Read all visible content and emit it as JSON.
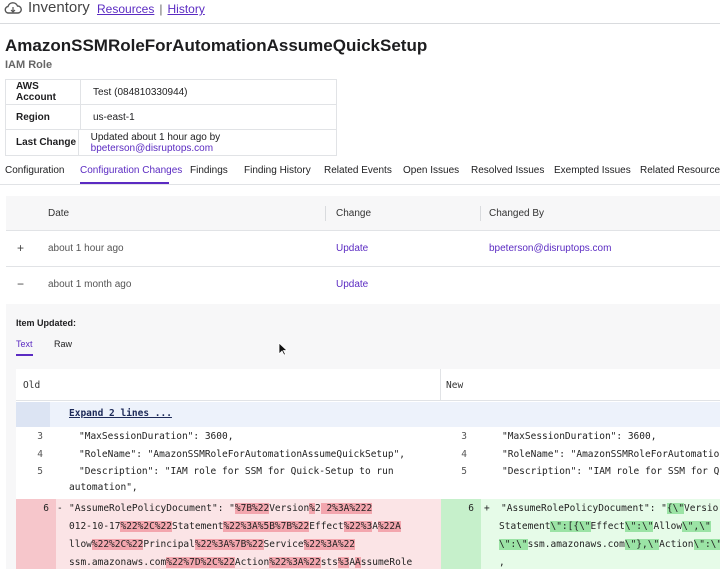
{
  "header": {
    "app_name": "Inventory",
    "breadcrumb_resources": "Resources",
    "breadcrumb_sep": "|",
    "breadcrumb_history": "History"
  },
  "resource": {
    "name": "AmazonSSMRoleForAutomationAssumeQuickSetup",
    "type": "IAM Role"
  },
  "info": {
    "rows": [
      {
        "key": "AWS Account",
        "value": "Test (084810330944)"
      },
      {
        "key": "Region",
        "value": "us-east-1"
      },
      {
        "key": "Last Change",
        "value_prefix": "Updated about 1 hour ago by ",
        "value_link": "bpeterson@disruptops.com"
      }
    ]
  },
  "tabs": [
    "Configuration",
    "Configuration Changes",
    "Findings",
    "Finding History",
    "Related Events",
    "Open Issues",
    "Resolved Issues",
    "Exempted Issues",
    "Related Resources"
  ],
  "changes": {
    "headers": {
      "date": "Date",
      "change": "Change",
      "changed_by": "Changed By"
    },
    "rows": [
      {
        "toggle": "+",
        "date": "about 1 hour ago",
        "change": "Update",
        "changed_by": "bpeterson@disruptops.com"
      },
      {
        "toggle": "−",
        "date": "about 1 month ago",
        "change": "Update",
        "changed_by": ""
      }
    ]
  },
  "detail": {
    "item_updated": "Item Updated:",
    "subtabs": [
      "Text",
      "Raw"
    ],
    "diff": {
      "old_label": "Old",
      "new_label": "New",
      "expand_label": "Expand 2 lines ...",
      "context_lines": [
        {
          "ln": "3",
          "old": "\"MaxSessionDuration\": 3600,",
          "new": "\"MaxSessionDuration\": 3600,"
        },
        {
          "ln": "4",
          "old": "\"RoleName\": \"AmazonSSMRoleForAutomationAssumeQuickSetup\",",
          "new": "\"RoleName\": \"AmazonSSMRoleForAutomation"
        },
        {
          "ln": "5",
          "old": "\"Description\": \"IAM role for SSM for Quick-Setup to run",
          "new": "\"Description\": \"IAM role for SSM for Qu"
        },
        {
          "ln": "",
          "old": "automation\",",
          "new": ""
        }
      ],
      "removed_ln": "6",
      "removed_sign": "-",
      "added_ln": "6",
      "added_sign": "+"
    }
  }
}
